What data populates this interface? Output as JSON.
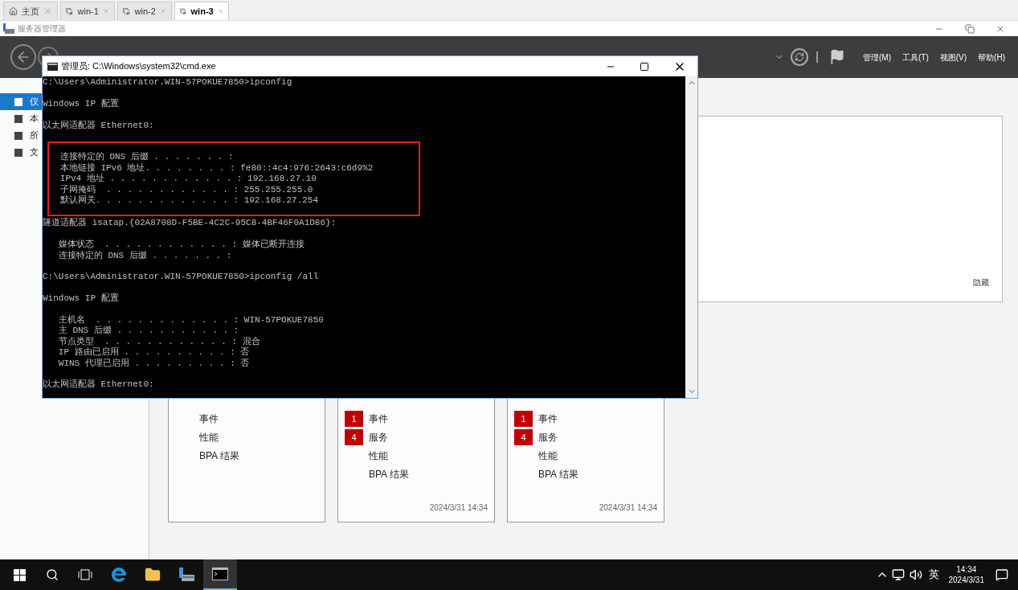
{
  "vm_tabs": [
    {
      "label": "主页",
      "kind": "home",
      "selected": false
    },
    {
      "label": "win-1",
      "kind": "vm",
      "selected": false
    },
    {
      "label": "win-2",
      "kind": "vm",
      "selected": false
    },
    {
      "label": "win-3",
      "kind": "vm",
      "selected": true
    }
  ],
  "app_window": {
    "title": "服务器管理器"
  },
  "header": {
    "menus": [
      "管理(M)",
      "工具(T)",
      "视图(V)",
      "帮助(H)"
    ]
  },
  "sidebar": {
    "items": [
      {
        "label": "仪",
        "selected": true
      },
      {
        "label": "本",
        "selected": false
      },
      {
        "label": "所",
        "selected": false
      },
      {
        "label": "文",
        "selected": false
      }
    ]
  },
  "panel": {
    "hide_link": "隐藏"
  },
  "cards": [
    {
      "rows": [
        {
          "label": "事件"
        },
        {
          "label": "性能"
        },
        {
          "label": "BPA 结果"
        }
      ]
    },
    {
      "rows": [
        {
          "label": "事件",
          "count": "1"
        },
        {
          "label": "服务",
          "count": "4"
        },
        {
          "label": "性能"
        },
        {
          "label": "BPA 结果"
        }
      ],
      "timestamp": "2024/3/31 14:34"
    },
    {
      "rows": [
        {
          "label": "事件",
          "count": "1"
        },
        {
          "label": "服务",
          "count": "4"
        },
        {
          "label": "性能"
        },
        {
          "label": "BPA 结果"
        }
      ],
      "timestamp": "2024/3/31 14:34"
    }
  ],
  "cmd_window": {
    "title": "管理员: C:\\Windows\\system32\\cmd.exe",
    "groups": [
      {
        "highlighted": false,
        "lines": [
          "C:\\Users\\Administrator.WIN-57POKUE7850>ipconfig"
        ]
      },
      {
        "highlighted": false,
        "lines": [
          "Windows IP 配置"
        ]
      },
      {
        "highlighted": false,
        "lines": [
          "以太网适配器 Ethernet0:"
        ]
      },
      {
        "highlighted": true,
        "lines": [
          "   连接特定的 DNS 后缀 . . . . . . . :",
          "   本地链接 IPv6 地址. . . . . . . . : fe80::4c4:976:2643:c6d9%2",
          "   IPv4 地址 . . . . . . . . . . . . : 192.168.27.10",
          "   子网掩码  . . . . . . . . . . . . : 255.255.255.0",
          "   默认网关. . . . . . . . . . . . . : 192.168.27.254"
        ]
      },
      {
        "highlighted": false,
        "lines": [
          "隧道适配器 isatap.{02A8708D-F5BE-4C2C-95C8-4BF46F0A1D86}:"
        ]
      },
      {
        "highlighted": false,
        "lines": [
          "   媒体状态  . . . . . . . . . . . . : 媒体已断开连接",
          "   连接特定的 DNS 后缀 . . . . . . . :"
        ]
      },
      {
        "highlighted": false,
        "lines": [
          "C:\\Users\\Administrator.WIN-57POKUE7850>ipconfig /all"
        ]
      },
      {
        "highlighted": false,
        "lines": [
          "Windows IP 配置"
        ]
      },
      {
        "highlighted": false,
        "lines": [
          "   主机名  . . . . . . . . . . . . . : WIN-57POKUE7850",
          "   主 DNS 后缀 . . . . . . . . . . . :",
          "   节点类型  . . . . . . . . . . . . : 混合",
          "   IP 路由已启用 . . . . . . . . . . : 否",
          "   WINS 代理已启用 . . . . . . . . . : 否"
        ]
      },
      {
        "highlighted": false,
        "lines": [
          "以太网适配器 Ethernet0:"
        ]
      }
    ]
  },
  "taskbar": {
    "apps": [
      {
        "kind": "edge",
        "active": false
      },
      {
        "kind": "explorer",
        "active": false
      },
      {
        "kind": "server",
        "active": false
      },
      {
        "kind": "cmd",
        "active": true
      }
    ],
    "ime": "英",
    "time": "14:34",
    "date": "2024/3/31"
  }
}
